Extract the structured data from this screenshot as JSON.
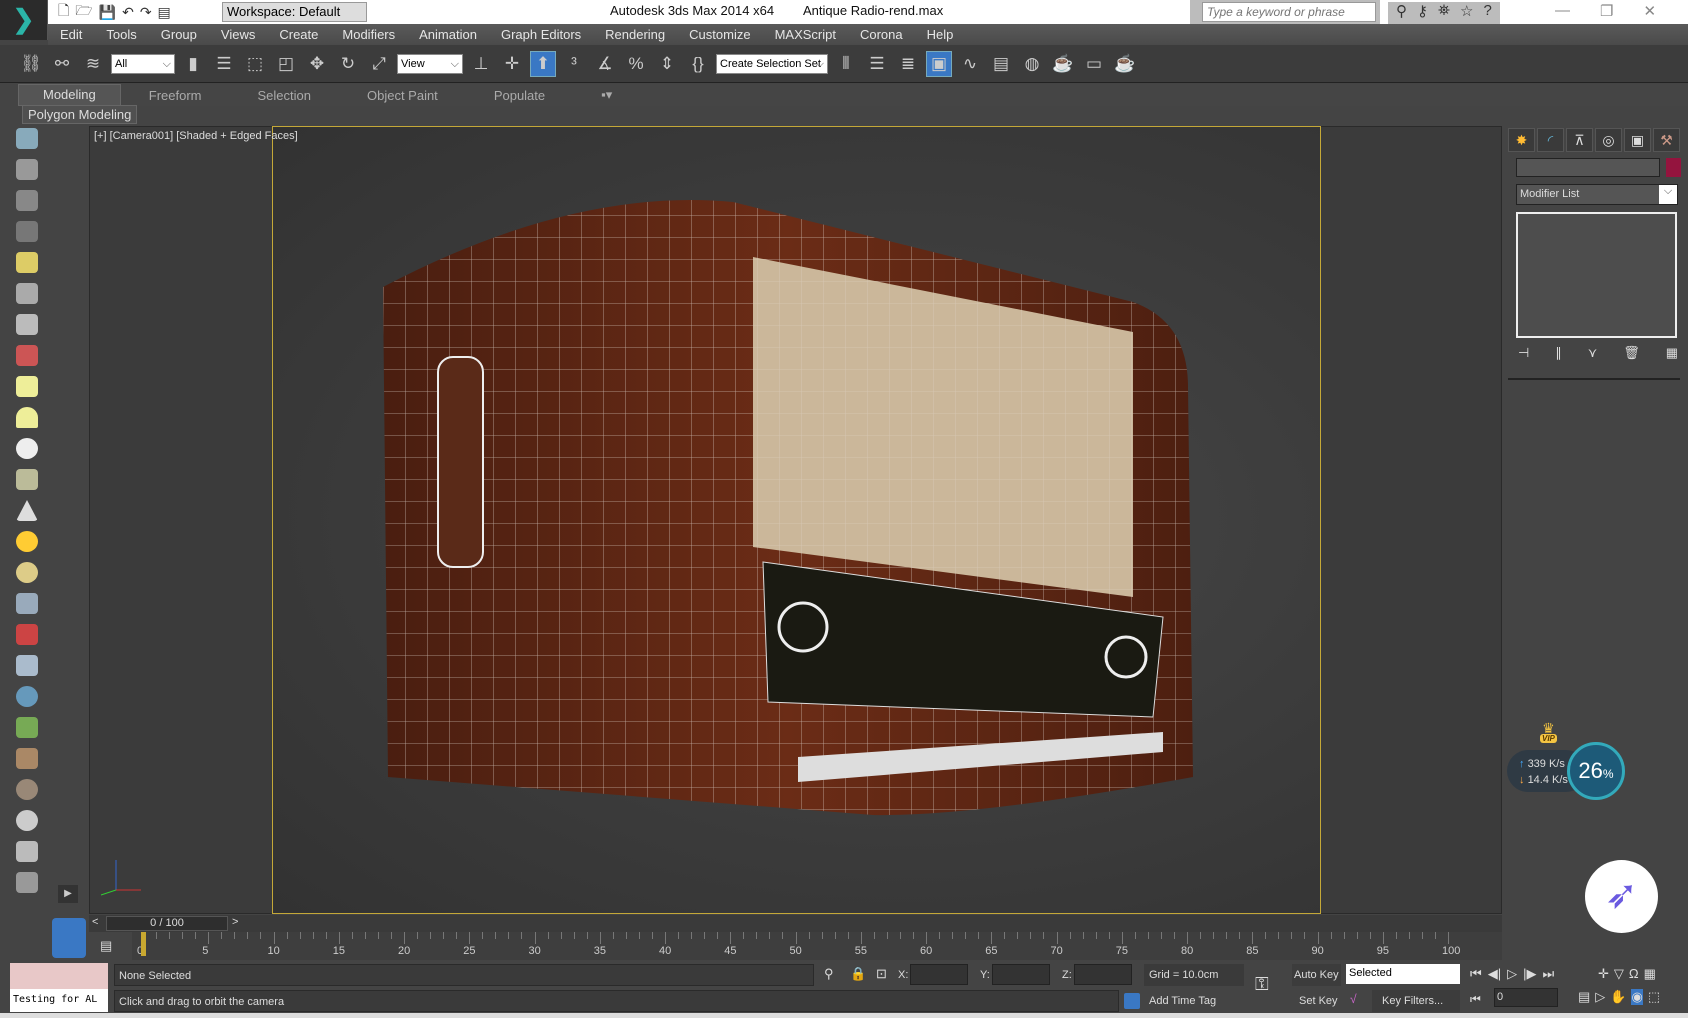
{
  "titlebar": {
    "workspace": "Workspace: Default",
    "app_title": "Autodesk 3ds Max  2014 x64",
    "file_title": "Antique Radio-rend.max",
    "search_placeholder": "Type a keyword or phrase"
  },
  "menu": [
    "Edit",
    "Tools",
    "Group",
    "Views",
    "Create",
    "Modifiers",
    "Animation",
    "Graph Editors",
    "Rendering",
    "Customize",
    "MAXScript",
    "Corona",
    "Help"
  ],
  "toolbar": {
    "selection_filter": "All",
    "ref_coord": "View",
    "named_selection": "Create Selection Set"
  },
  "ribbon": {
    "tabs": [
      "Modeling",
      "Freeform",
      "Selection",
      "Object Paint",
      "Populate"
    ],
    "active": "Modeling",
    "panel": "Polygon Modeling"
  },
  "viewport": {
    "label": "[+] [Camera001] [Shaded + Edged Faces]"
  },
  "command_panel": {
    "modifier_list": "Modifier List",
    "color": "#94143e"
  },
  "network": {
    "upload": "339 K/s",
    "download": "14.4 K/s",
    "percent": "26",
    "percent_sign": "%",
    "badge": "VIP"
  },
  "timeline": {
    "frame": "0 / 100",
    "ticks": [
      "0",
      "5",
      "10",
      "15",
      "20",
      "25",
      "30",
      "35",
      "40",
      "45",
      "50",
      "55",
      "60",
      "65",
      "70",
      "75",
      "80",
      "85",
      "90",
      "95",
      "100"
    ]
  },
  "status": {
    "selection": "None Selected",
    "prompt": "Click and drag to orbit the camera",
    "maxscript": "Testing for AL",
    "x_label": "X:",
    "y_label": "Y:",
    "z_label": "Z:",
    "grid": "Grid = 10.0cm",
    "add_time_tag": "Add Time Tag",
    "auto_key": "Auto Key",
    "set_key": "Set Key",
    "key_mode": "Selected",
    "key_filters": "Key Filters...",
    "current_frame": "0"
  }
}
